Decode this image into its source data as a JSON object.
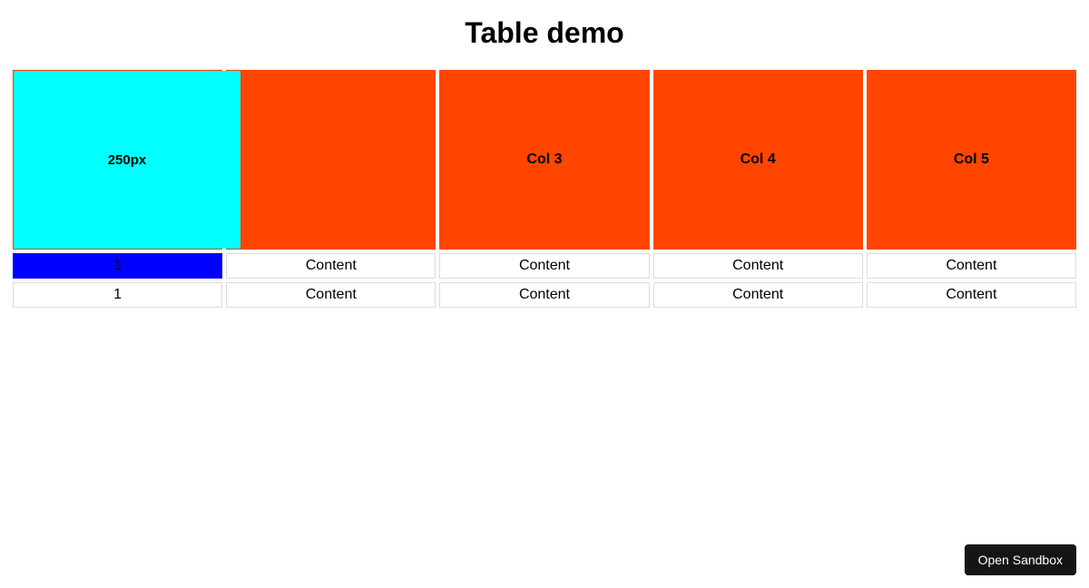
{
  "page": {
    "title": "Table demo"
  },
  "table": {
    "headers": [
      "250px",
      "",
      "Col 3",
      "Col 4",
      "Col 5"
    ],
    "rows": [
      {
        "first_cell_bg": "blue",
        "cells": [
          "1",
          "Content",
          "Content",
          "Content",
          "Content"
        ]
      },
      {
        "first_cell_bg": "white",
        "cells": [
          "1",
          "Content",
          "Content",
          "Content",
          "Content"
        ]
      }
    ]
  },
  "button": {
    "open_sandbox": "Open Sandbox"
  },
  "colors": {
    "header_bg": "#ff4500",
    "first_header_inner": "#00ffff",
    "row1_first_cell": "#0000ff"
  }
}
